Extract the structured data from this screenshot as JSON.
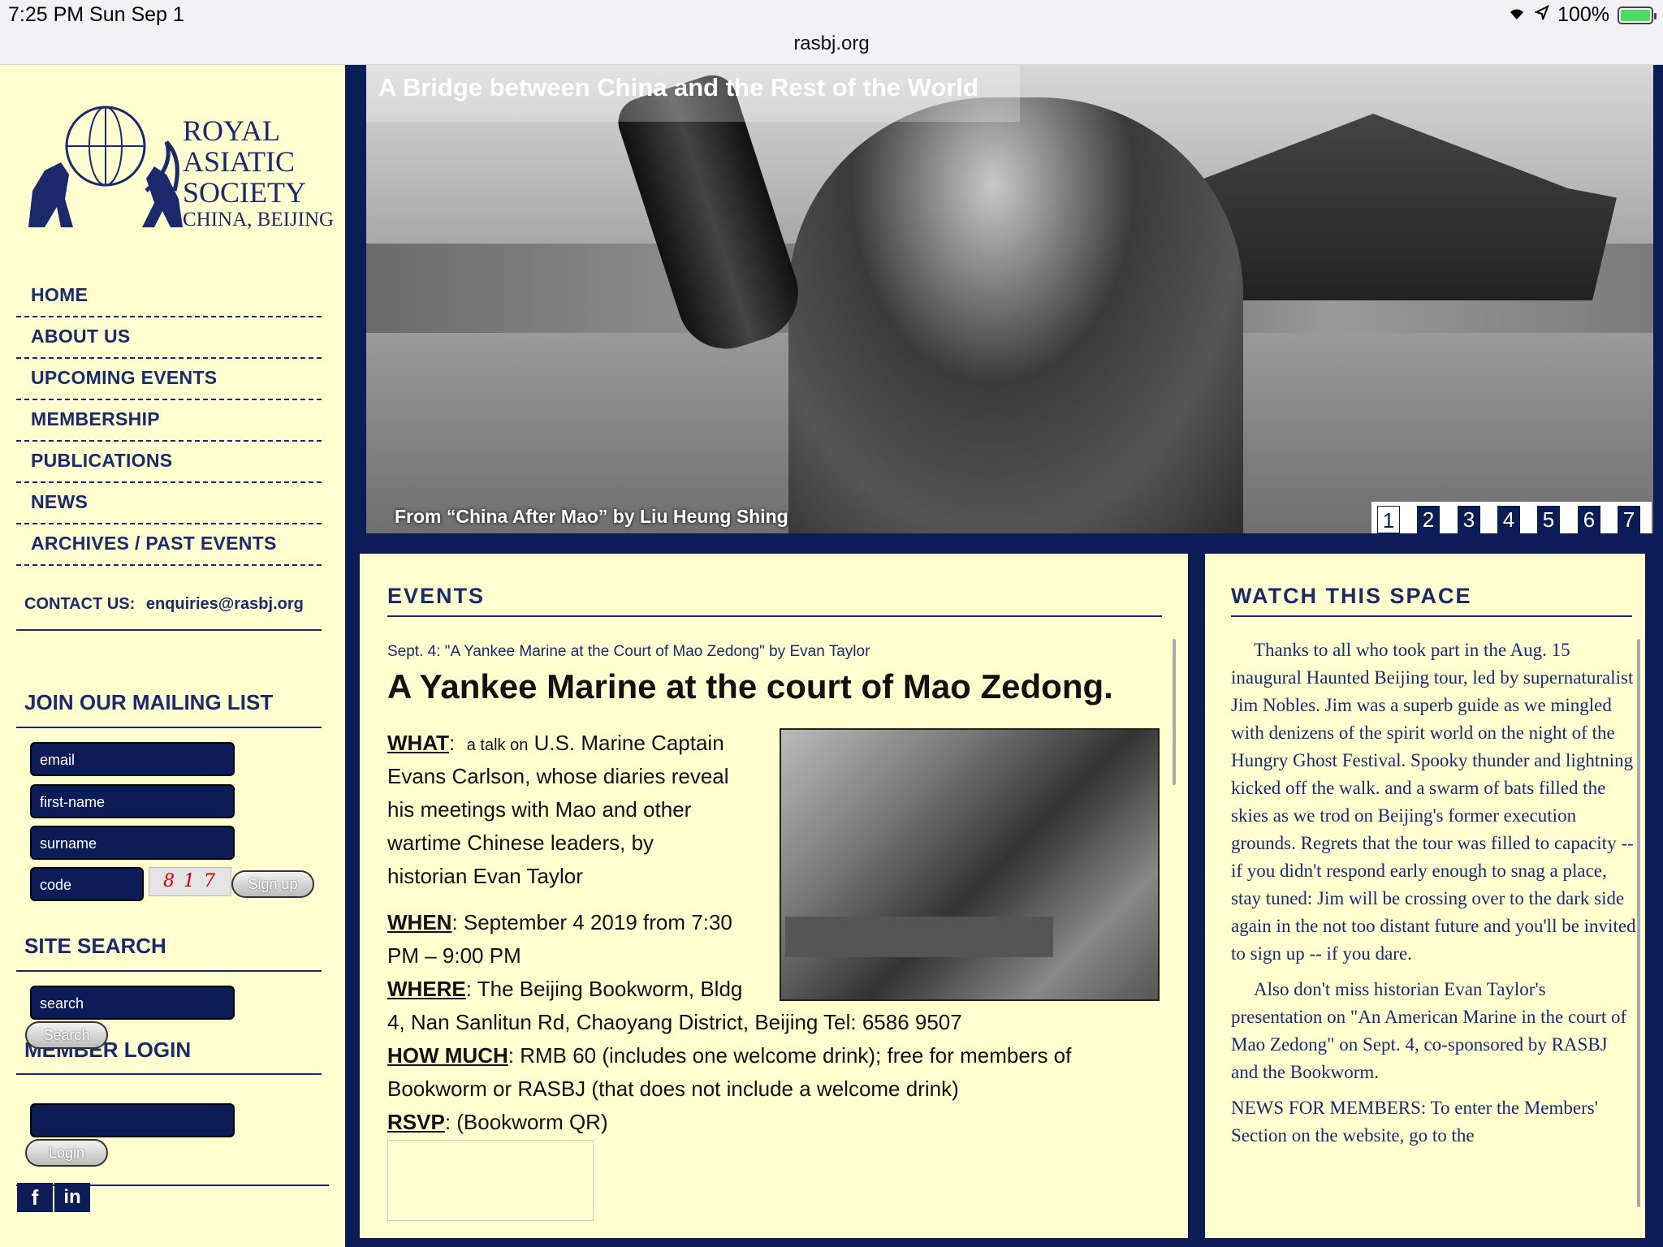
{
  "status_bar": {
    "time": "7:25 PM   Sun Sep 1",
    "url": "rasbj.org",
    "battery": "100%"
  },
  "logo": {
    "line1": "ROYAL",
    "line2": "ASIATIC",
    "line3": "SOCIETY",
    "line4": "CHINA, BEIJING"
  },
  "nav": [
    "HOME",
    "ABOUT US",
    "UPCOMING EVENTS",
    "MEMBERSHIP",
    "PUBLICATIONS",
    "NEWS",
    "ARCHIVES / PAST EVENTS"
  ],
  "contact": {
    "label": "CONTACT US:",
    "email": "enquiries@rasbj.org"
  },
  "mailing": {
    "heading": "JOIN OUR MAILING LIST",
    "email_placeholder": "email",
    "firstname_placeholder": "first-name",
    "surname_placeholder": "surname",
    "code_placeholder": "code",
    "captcha_text": "8 1 7",
    "signup_label": "Sign up"
  },
  "search": {
    "heading": "SITE SEARCH",
    "placeholder": "search",
    "button": "Search"
  },
  "login": {
    "heading": "MEMBER LOGIN",
    "button": "Login"
  },
  "social": {
    "facebook": "f",
    "linkedin": "in"
  },
  "hero": {
    "title": "A Bridge between China and the Rest of the World",
    "caption": "From “China After Mao” by Liu Heung Shing",
    "pages": [
      "1",
      "2",
      "3",
      "4",
      "5",
      "6",
      "7"
    ],
    "active_page": "1"
  },
  "events": {
    "heading": "EVENTS",
    "date_line": "Sept. 4: \"A Yankee Marine at the Court of Mao Zedong\" by Evan Taylor",
    "title": "A Yankee Marine at the court of Mao Zedong.",
    "what_label": "WHAT",
    "what_small": "a talk on",
    "what_l1": "U.S. Marine Captain",
    "what_l2": "Evans Carlson, whose diaries reveal",
    "what_l3": "his meetings with Mao and other",
    "what_l4": "wartime Chinese leaders, by",
    "what_l5": "historian Evan Taylor",
    "when_label": "WHEN",
    "when_l1": ": September 4 2019  from 7:30",
    "when_l2": "PM – 9:00 PM",
    "where_label": "WHERE",
    "where_l1": ": The Beijing Bookworm, Bldg",
    "where_l2": "4, Nan Sanlitun Rd, Chaoyang District, Beijing Tel: 6586 9507",
    "howmuch_label": "HOW MUCH",
    "howmuch_l1": ": RMB 60 (includes one welcome drink); free for members of",
    "howmuch_l2": "Bookworm or RASBJ (that does not include a welcome drink)",
    "rsvp_label": "RSVP",
    "rsvp_text": ":  (Bookworm QR)"
  },
  "watch": {
    "heading": "WATCH THIS SPACE",
    "p1": "Thanks to all who took part in the Aug. 15 inaugural Haunted Beijing tour, led by supernaturalist Jim Nobles. Jim was a superb guide as we mingled with denizens of the spirit world on the night of the Hungry Ghost Festival.  Spooky thunder and lightning kicked off the walk. and a swarm of bats filled the skies as we trod on Beijing's former execution grounds.  Regrets that the tour was filled to capacity -- if you didn't respond early enough to snag a place, stay tuned: Jim will be crossing over to the dark side again in the not too distant future and you'll be invited to sign up -- if you dare.",
    "p2": "Also don't miss historian Evan Taylor's presentation on \"An American Marine in the court of Mao Zedong\" on Sept. 4, co-sponsored by RASBJ and the Bookworm.",
    "p3": "NEWS FOR MEMBERS: To enter the Members' Section on the website, go to the"
  }
}
